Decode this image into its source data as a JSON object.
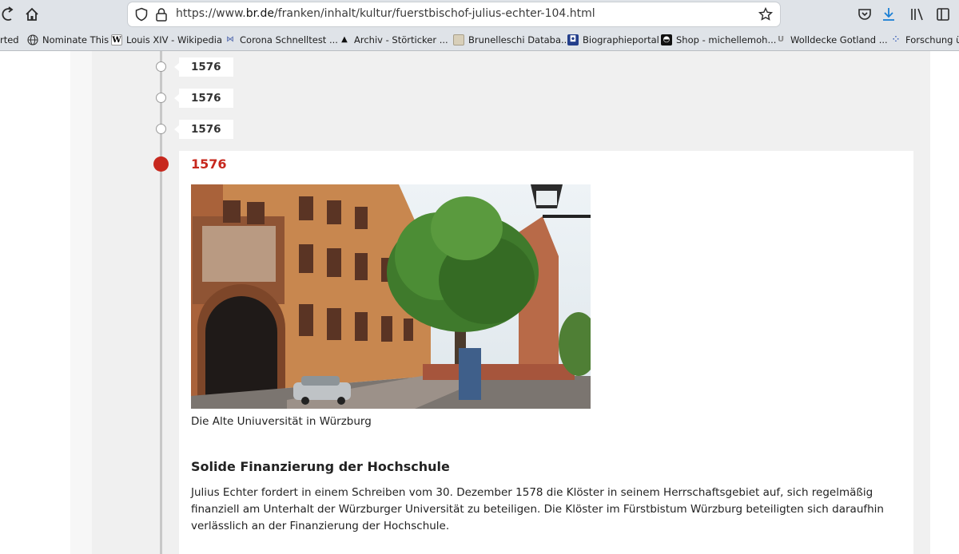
{
  "browser": {
    "url_prefix": "https://www.",
    "url_domain": "br.de",
    "url_path": "/franken/inhalt/kultur/fuerstbischof-julius-echter-104.html"
  },
  "bookmarks": [
    {
      "label": "rted",
      "icon": "none"
    },
    {
      "label": "Nominate This",
      "icon": "globe-icon"
    },
    {
      "label": "Louis XIV - Wikipedia",
      "icon": "wikipedia-icon"
    },
    {
      "label": "Corona Schnelltest ...",
      "icon": "bird-icon"
    },
    {
      "label": "Archiv - Störticker ...",
      "icon": "warning-icon"
    },
    {
      "label": "Brunelleschi Databa...",
      "icon": "dome-icon"
    },
    {
      "label": "Biographieportal",
      "icon": "portal-icon"
    },
    {
      "label": "Shop - michellemoh...",
      "icon": "shop-icon"
    },
    {
      "label": "Wolldecke Gotland ...",
      "icon": "u-icon"
    },
    {
      "label": "Forschung üb",
      "icon": "dots-icon"
    }
  ],
  "timeline": {
    "items": [
      {
        "label": "1576"
      },
      {
        "label": "1576"
      },
      {
        "label": "1576"
      }
    ],
    "active": {
      "year": "1576",
      "caption": "Die Alte Uniuversität in Würzburg",
      "heading": "Solide Finanzierung der Hochschule",
      "body": "Julius Echter fordert in einem Schreiben vom 30. Dezember 1578 die Klöster in seinem Herrschaftsgebiet auf, sich regelmäßig finanziell am Unterhalt der Würzburger Universität zu beteiligen. Die Klöster im Fürstbistum Würzburg beteiligten sich daraufhin verlässlich an der Finanzierung der Hochschule."
    }
  },
  "colors": {
    "accent_red": "#c7281e",
    "chrome_bg": "#dfe3e8",
    "band_gray": "#f0f0f0"
  }
}
